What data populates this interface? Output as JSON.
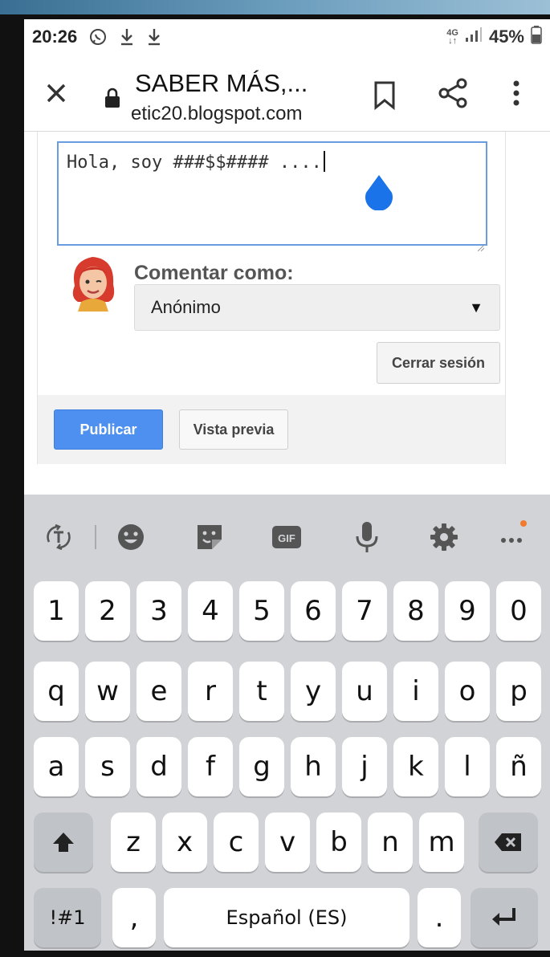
{
  "status_bar": {
    "time": "20:26",
    "icons": [
      "whatsapp-icon",
      "download-icon",
      "download-icon"
    ],
    "network": "4G",
    "battery": "45%"
  },
  "browser": {
    "title": "SABER MÁS,...",
    "url": "etic20.blogspot.com",
    "icons": [
      "close-icon",
      "lock-icon",
      "bookmark-icon",
      "share-icon",
      "more-vert-icon"
    ]
  },
  "comment_form": {
    "text": "Hola, soy ###$$#### ....",
    "comment_as_label": "Comentar como:",
    "identity_select": "Anónimo",
    "logout_button": "Cerrar sesión",
    "publish_button": "Publicar",
    "preview_button": "Vista previa"
  },
  "keyboard": {
    "toolbar": [
      "text-translate-icon",
      "emoji-icon",
      "sticker-icon",
      "gif-icon",
      "mic-icon",
      "settings-icon",
      "more-icon"
    ],
    "gif_label": "GIF",
    "numbers": [
      "1",
      "2",
      "3",
      "4",
      "5",
      "6",
      "7",
      "8",
      "9",
      "0"
    ],
    "row1": [
      "q",
      "w",
      "e",
      "r",
      "t",
      "y",
      "u",
      "i",
      "o",
      "p"
    ],
    "row2": [
      "a",
      "s",
      "d",
      "f",
      "g",
      "h",
      "j",
      "k",
      "l",
      "ñ"
    ],
    "row3": [
      "z",
      "x",
      "c",
      "v",
      "b",
      "n",
      "m"
    ],
    "symbols_key": "!#1",
    "comma_key": ",",
    "space_label": "Español (ES)",
    "period_key": ".",
    "accent_color": "#4d90f0"
  }
}
